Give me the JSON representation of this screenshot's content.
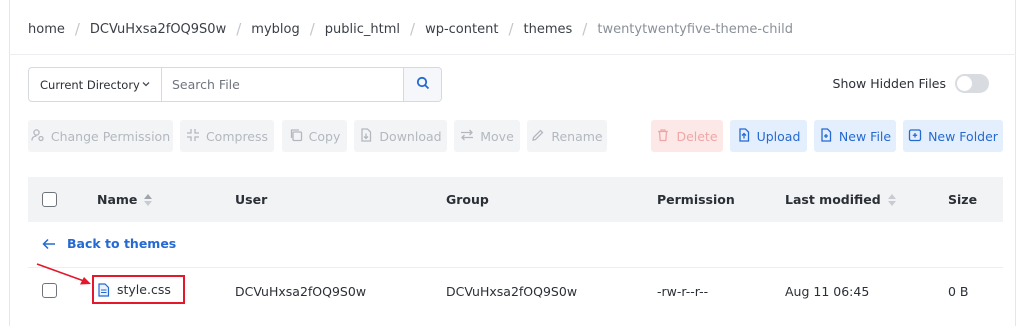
{
  "breadcrumb": [
    {
      "label": "home"
    },
    {
      "label": "DCVuHxsa2fOQ9S0w"
    },
    {
      "label": "myblog"
    },
    {
      "label": "public_html"
    },
    {
      "label": "wp-content"
    },
    {
      "label": "themes"
    },
    {
      "label": "twentytwentyfive-theme-child"
    }
  ],
  "search": {
    "scope": "Current Directory",
    "placeholder": "Search File"
  },
  "hidden_files": {
    "label": "Show Hidden Files",
    "enabled": false
  },
  "toolbar": {
    "change_permission": "Change Permission",
    "compress": "Compress",
    "copy": "Copy",
    "download": "Download",
    "move": "Move",
    "rename": "Rename",
    "delete": "Delete",
    "upload": "Upload",
    "new_file": "New File",
    "new_folder": "New Folder"
  },
  "table": {
    "headers": {
      "name": "Name",
      "user": "User",
      "group": "Group",
      "permission": "Permission",
      "last_modified": "Last modified",
      "size": "Size"
    },
    "back_link": "Back to themes",
    "rows": [
      {
        "name": "style.css",
        "user": "DCVuHxsa2fOQ9S0w",
        "group": "DCVuHxsa2fOQ9S0w",
        "permission": "-rw-r--r--",
        "last_modified": "Aug 11 06:45",
        "size": "0 B"
      }
    ]
  },
  "colors": {
    "accent": "#2569d2",
    "highlight": "#e3182a",
    "danger": "#f0a6a6"
  }
}
